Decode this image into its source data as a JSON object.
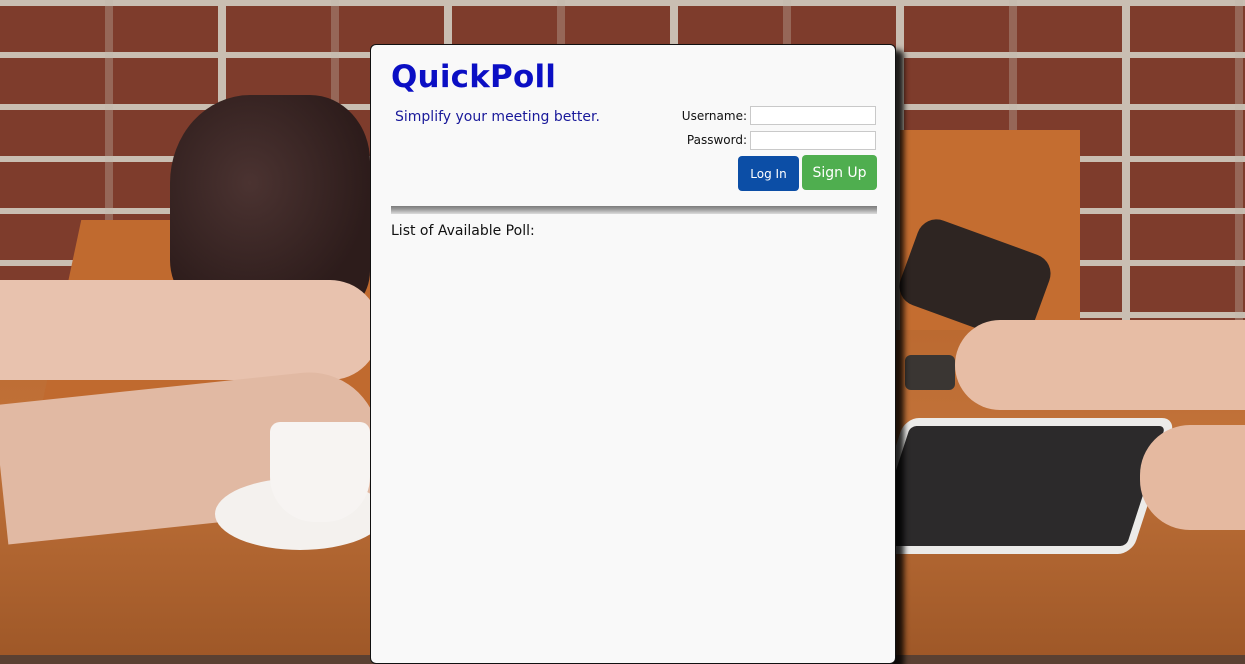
{
  "app": {
    "title": "QuickPoll",
    "tagline": "Simplify your meeting better."
  },
  "login": {
    "username_label": "Username:",
    "username_value": "",
    "password_label": "Password:",
    "password_value": "",
    "login_button": "Log In",
    "signup_button": "Sign Up"
  },
  "polls": {
    "heading": "List of Available Poll:",
    "items": []
  },
  "colors": {
    "title": "#0b0fc4",
    "tagline": "#19199a",
    "login_button": "#0c4ea6",
    "signup_button": "#4fae4f",
    "panel": "#f9f9f9"
  }
}
